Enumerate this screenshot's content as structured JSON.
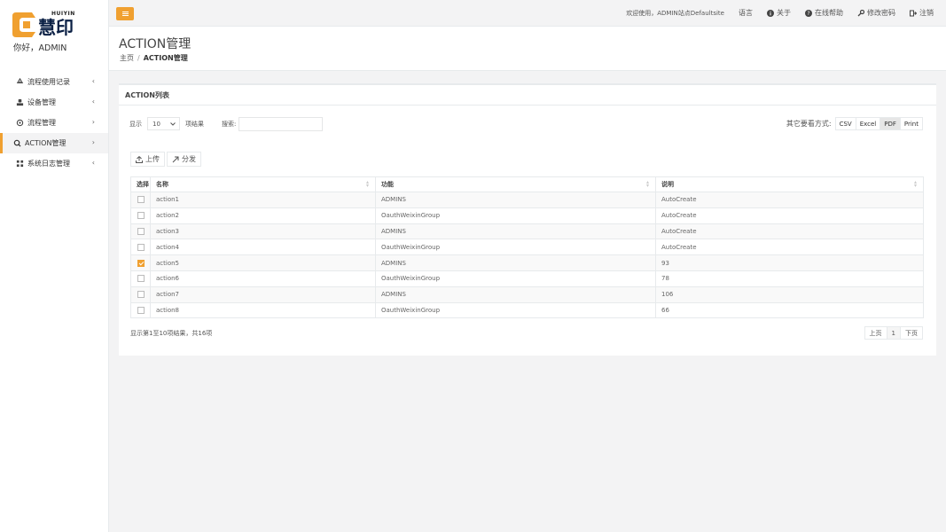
{
  "brand": {
    "name_en": "HUIYIN",
    "name_cn": "慧印",
    "greeting": "你好，ADMIN"
  },
  "sidebar": {
    "items": [
      {
        "label": "流程使用记录",
        "icon": "recycle-icon",
        "chevron": "‹",
        "active": false
      },
      {
        "label": "设备管理",
        "icon": "stamp-icon",
        "chevron": "‹",
        "active": false
      },
      {
        "label": "流程管理",
        "icon": "network-icon",
        "chevron": "›",
        "active": false
      },
      {
        "label": "ACTION管理",
        "icon": "search-icon",
        "chevron": "›",
        "active": true
      },
      {
        "label": "系统日志管理",
        "icon": "grid-icon",
        "chevron": "‹",
        "active": false
      }
    ]
  },
  "topbar": {
    "welcome": "欢迎使用，ADMIN站点Defaultsite",
    "language": "语言",
    "about": "关于",
    "help": "在线帮助",
    "change_password": "修改密码",
    "logout": "注销"
  },
  "page": {
    "title": "ACTION管理",
    "breadcrumb_home": "主页",
    "breadcrumb_sep": "/",
    "breadcrumb_current": "ACTION管理"
  },
  "card": {
    "title": "ACTION列表",
    "length_prefix": "显示",
    "length_value": "10",
    "length_suffix": "项结果",
    "search_label": "搜索:",
    "search_placeholder": "",
    "export_label": "其它要看方式:",
    "export_buttons": [
      "CSV",
      "Excel",
      "PDF",
      "Print"
    ],
    "upload_label": "上传",
    "distribute_label": "分发",
    "info": "显示第1至10项结果，共16项",
    "pager": {
      "prev": "上页",
      "page": "1",
      "next": "下页"
    }
  },
  "table": {
    "headers": [
      "选择",
      "名称",
      "功能",
      "说明"
    ],
    "rows": [
      {
        "checked": false,
        "name": "action1",
        "func": "ADMINS",
        "desc": "AutoCreate"
      },
      {
        "checked": false,
        "name": "action2",
        "func": "OauthWeixinGroup",
        "desc": "AutoCreate"
      },
      {
        "checked": false,
        "name": "action3",
        "func": "ADMINS",
        "desc": "AutoCreate"
      },
      {
        "checked": false,
        "name": "action4",
        "func": "OauthWeixinGroup",
        "desc": "AutoCreate"
      },
      {
        "checked": true,
        "name": "action5",
        "func": "ADMINS",
        "desc": "93"
      },
      {
        "checked": false,
        "name": "action6",
        "func": "OauthWeixinGroup",
        "desc": "78"
      },
      {
        "checked": false,
        "name": "action7",
        "func": "ADMINS",
        "desc": "106"
      },
      {
        "checked": false,
        "name": "action8",
        "func": "OauthWeixinGroup",
        "desc": "66"
      }
    ]
  },
  "colors": {
    "accent": "#f0a030",
    "brand_navy": "#0a1f44"
  }
}
